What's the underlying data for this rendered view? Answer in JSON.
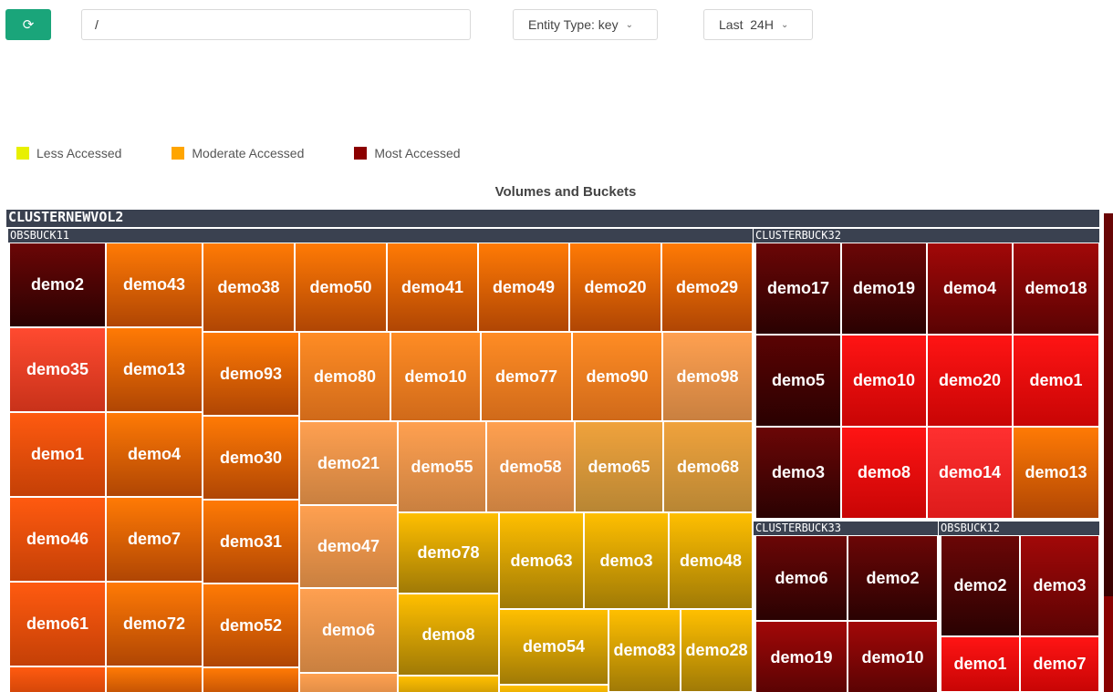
{
  "toolbar": {
    "refresh_icon": "refresh-icon",
    "path_value": "/",
    "entity_type_label": "Entity Type: key",
    "time_range_label": "Last  24H"
  },
  "legend": [
    {
      "label": "Less Accessed",
      "color": "#e8f000"
    },
    {
      "label": "Moderate Accessed",
      "color": "#ffa500"
    },
    {
      "label": "Most Accessed",
      "color": "#8b0000"
    }
  ],
  "treemap": {
    "title": "Volumes and Buckets",
    "volume": "CLUSTERNEWVOL2",
    "buckets": [
      {
        "name": "OBSBUCK11",
        "keys": [
          "demo2",
          "demo43",
          "demo38",
          "demo50",
          "demo41",
          "demo49",
          "demo20",
          "demo29",
          "demo35",
          "demo13",
          "demo93",
          "demo80",
          "demo10",
          "demo77",
          "demo90",
          "demo98",
          "demo1",
          "demo4",
          "demo30",
          "demo21",
          "demo55",
          "demo58",
          "demo65",
          "demo68",
          "demo46",
          "demo7",
          "demo31",
          "demo47",
          "demo78",
          "demo63",
          "demo3",
          "demo48",
          "demo61",
          "demo72",
          "demo52",
          "demo6",
          "demo8",
          "demo54",
          "demo83",
          "demo28"
        ]
      },
      {
        "name": "CLUSTERBUCK32",
        "keys": [
          "demo17",
          "demo19",
          "demo4",
          "demo18",
          "demo5",
          "demo10",
          "demo20",
          "demo1",
          "demo3",
          "demo8",
          "demo14",
          "demo13"
        ]
      },
      {
        "name": "CLUSTERBUCK33",
        "keys": [
          "demo6",
          "demo2",
          "demo19",
          "demo10"
        ]
      },
      {
        "name": "OBSBUCK12",
        "keys": [
          "demo2",
          "demo3",
          "demo1",
          "demo7"
        ]
      }
    ]
  }
}
